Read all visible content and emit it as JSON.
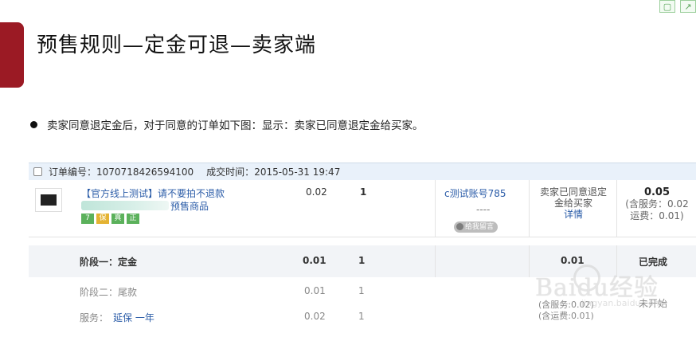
{
  "slide": {
    "title": "预售规则—定金可退—卖家端",
    "bullet": "卖家同意退定金后，对于同意的订单如下图：显示：卖家已同意退定金给买家。",
    "corner_icons": [
      "window-icon",
      "share-icon"
    ]
  },
  "order": {
    "order_no_label": "订单编号：",
    "order_no": "1070718426594100",
    "deal_time_label": "成交时间：",
    "deal_time": "2015-05-31 19:47",
    "product_title": "【官方线上测试】请不要拍不退款",
    "presale_tag": "预售商品",
    "badges": [
      "7",
      "保",
      "真",
      "正"
    ],
    "unit_price": "0.02",
    "quantity": "1",
    "buyer_name": "c测试账号785",
    "buyer_dash": "----",
    "message_button": "给我留言",
    "status": {
      "line1": "卖家已同意退定",
      "line2": "金给买家",
      "detail": "详情"
    },
    "total": {
      "amount": "0.05",
      "service": "(含服务：0.02",
      "shipping": "运费：0.01)"
    }
  },
  "stages": {
    "stage1": {
      "label": "阶段一：定金",
      "price": "0.01",
      "qty": "1",
      "amount": "0.01",
      "status": "已完成"
    },
    "stage2": {
      "label": "阶段二：尾款",
      "price": "0.01",
      "qty": "1",
      "service_line": "(含服务:0.02)",
      "shipping_line": "(含运费:0.01)",
      "status": "未开始"
    },
    "service": {
      "label": "服务：",
      "name": "延保 一年",
      "price": "0.02",
      "qty": "1"
    }
  },
  "watermark": {
    "text": "Baidu经验",
    "sub": "jingyan.baidu.com"
  },
  "colors": {
    "accent": "#9b1a24",
    "link": "#2b5ca8",
    "header_bg": "#e9f1fa",
    "stage_bg": "#f2f4f7"
  }
}
